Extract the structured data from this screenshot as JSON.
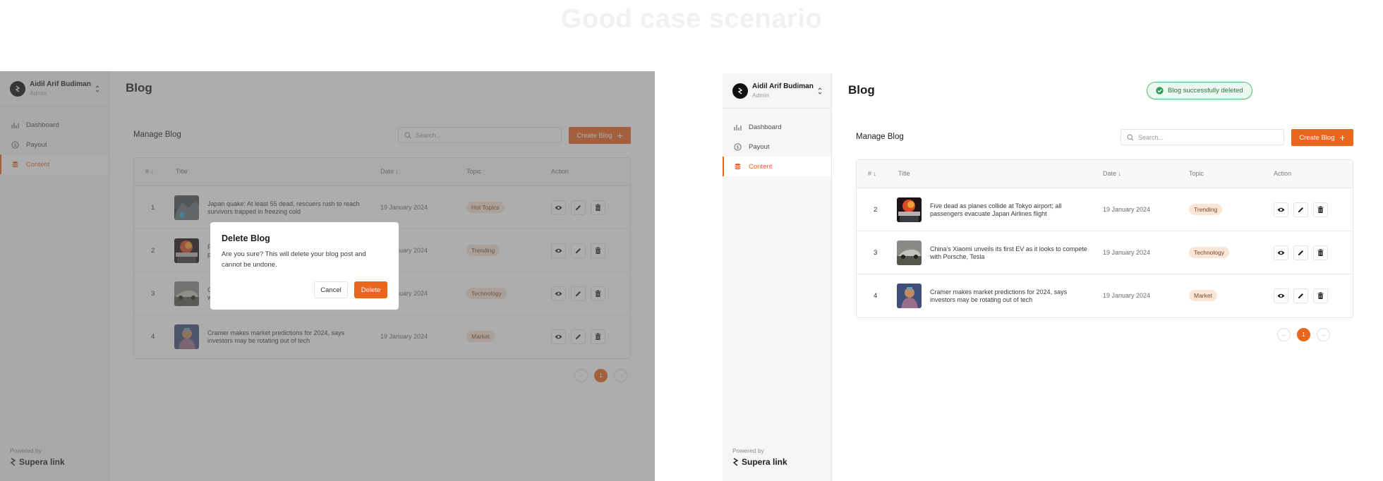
{
  "page_heading": "Good case scenario",
  "sidebar": {
    "user_name": "Aidil Arif Budiman",
    "user_role": "Admin",
    "nav": [
      {
        "label": "Dashboard",
        "icon": "bar-chart-icon"
      },
      {
        "label": "Payout",
        "icon": "dollar-circle-icon"
      },
      {
        "label": "Content",
        "icon": "database-icon"
      }
    ],
    "active_item": "Content",
    "powered_by": "Powered by",
    "brand": "Supera link"
  },
  "header": {
    "title": "Blog"
  },
  "manage": {
    "title": "Manage Blog",
    "search_placeholder": "Search...",
    "create_label": "Create Blog"
  },
  "table_headers": {
    "num": "#",
    "title": "Title",
    "date": "Date",
    "topic": "Topic",
    "action": "Action"
  },
  "left_rows": [
    {
      "num": "1",
      "title": "Japan quake: At least 55 dead, rescuers rush to reach survivors trapped in freezing cold",
      "date": "19 January 2024",
      "topic": "Hot Topics",
      "thumb": "quake"
    },
    {
      "num": "2",
      "title": "Five dead as planes collide at Tokyo airport; all passengers evacuate Japan Airlines flight",
      "date": "19 January 2024",
      "topic": "Trending",
      "thumb": "fire"
    },
    {
      "num": "3",
      "title": "China's Xiaomi unveils its first EV as it looks to compete with Porsche, Tesla",
      "date": "19 January 2024",
      "topic": "Technology",
      "thumb": "car"
    },
    {
      "num": "4",
      "title": "Cramer makes market predictions for 2024, says investors may be rotating out of tech",
      "date": "19 January 2024",
      "topic": "Market",
      "thumb": "statue"
    }
  ],
  "left_rows_visible": {
    "row2_title": "F\np",
    "row2_date": "anuary 2024",
    "row3_title": "C\nw",
    "row3_date": "anuary 2024"
  },
  "right_rows": [
    {
      "num": "2",
      "title": "Five dead as planes collide at Tokyo airport; all passengers evacuate Japan Airlines flight",
      "date": "19 January 2024",
      "topic": "Trending",
      "thumb": "fire"
    },
    {
      "num": "3",
      "title": "China's Xiaomi unveils its first EV as it looks to compete with Porsche, Tesla",
      "date": "19 January 2024",
      "topic": "Technology",
      "thumb": "car"
    },
    {
      "num": "4",
      "title": "Cramer makes market predictions for 2024, says investors may be rotating out of tech",
      "date": "19 January 2024",
      "topic": "Market",
      "thumb": "statue"
    }
  ],
  "pagination": {
    "current": "1",
    "prev_icon": "arrow-left-icon",
    "next_icon": "arrow-right-icon"
  },
  "modal": {
    "title": "Delete Blog",
    "body": "Are you sure? This will delete your blog post and cannot be undone.",
    "cancel": "Cancel",
    "delete": "Delete"
  },
  "toast": {
    "text": "Blog successfully deleted"
  },
  "colors": {
    "accent": "#e8671c",
    "tag_bg": "#fbe5d6",
    "toast_green": "#5fbf7c",
    "overlay": "rgba(92,92,92,0.5)"
  }
}
